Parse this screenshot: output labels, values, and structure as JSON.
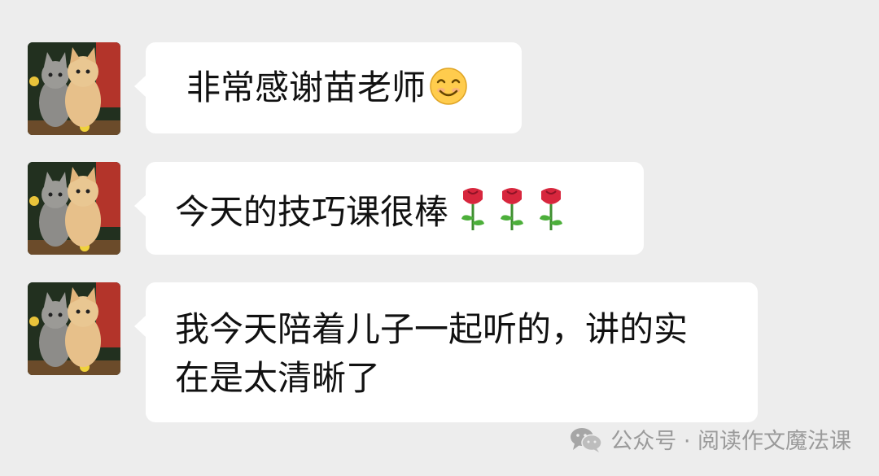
{
  "messages": [
    {
      "text": "非常感谢苗老师",
      "emoji": "smiling-face-emoji"
    },
    {
      "text": "今天的技巧课很棒",
      "emoji": "rose-emoji",
      "emoji_count": 3
    },
    {
      "line1": "我今天陪着儿子一起听的，讲的实",
      "line2": "在是太清晰了"
    }
  ],
  "footer": {
    "icon": "wechat-icon",
    "label": "公众号 · 阅读作文魔法课"
  },
  "colors": {
    "background": "#ededed",
    "bubble": "#ffffff",
    "text": "#111111",
    "watermark": "#9a9a9a"
  }
}
